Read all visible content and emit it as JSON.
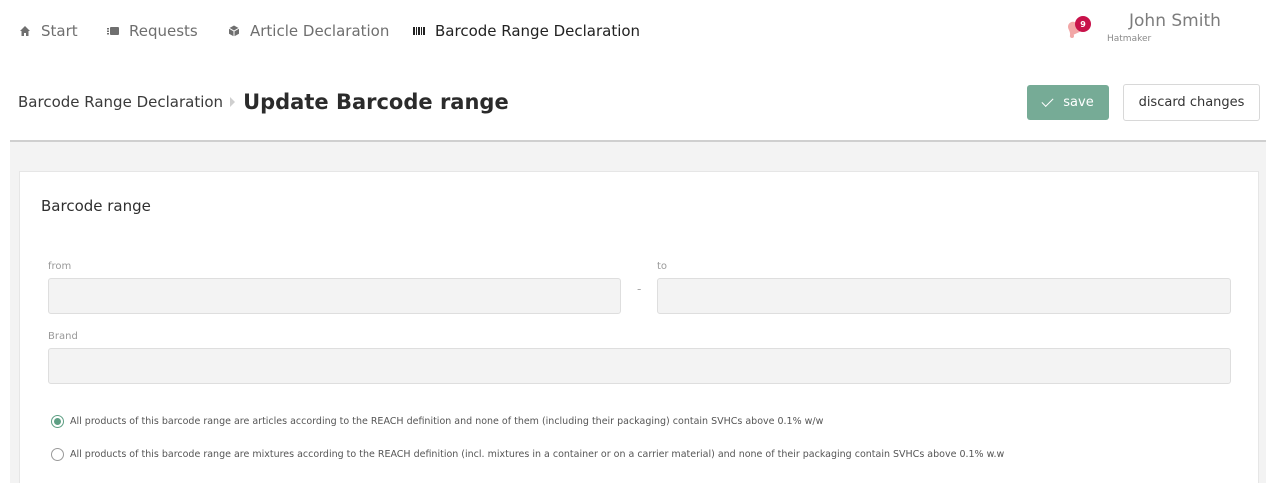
{
  "nav": {
    "items": [
      {
        "label": "Start",
        "icon": "home-icon"
      },
      {
        "label": "Requests",
        "icon": "requests-icon"
      },
      {
        "label": "Article Declaration",
        "icon": "article-icon"
      },
      {
        "label": "Barcode Range Declaration",
        "icon": "barcode-icon",
        "active": true
      }
    ]
  },
  "user": {
    "name": "John Smith",
    "role": "Hatmaker",
    "notification_count": "9"
  },
  "header": {
    "breadcrumb_parent": "Barcode Range Declaration",
    "title": "Update Barcode range",
    "save_label": "save",
    "discard_label": "discard changes"
  },
  "form": {
    "section_title": "Barcode range",
    "from_label": "from",
    "from_value": "",
    "to_label": "to",
    "to_value": "",
    "range_separator": "-",
    "brand_label": "Brand",
    "brand_value": "",
    "options": [
      {
        "label": "All products of this barcode range are articles according to the REACH definition and none of them (including their packaging) contain SVHCs above 0.1% w/w",
        "selected": true
      },
      {
        "label": "All products of this barcode range are mixtures according to the REACH definition (incl. mixtures in a container or on a carrier material) and none of their packaging contain SVHCs above 0.1% w.w",
        "selected": false
      }
    ]
  },
  "colors": {
    "accent": "#76ab96",
    "badge": "#c8124a",
    "bell": "#f2a7a7"
  }
}
